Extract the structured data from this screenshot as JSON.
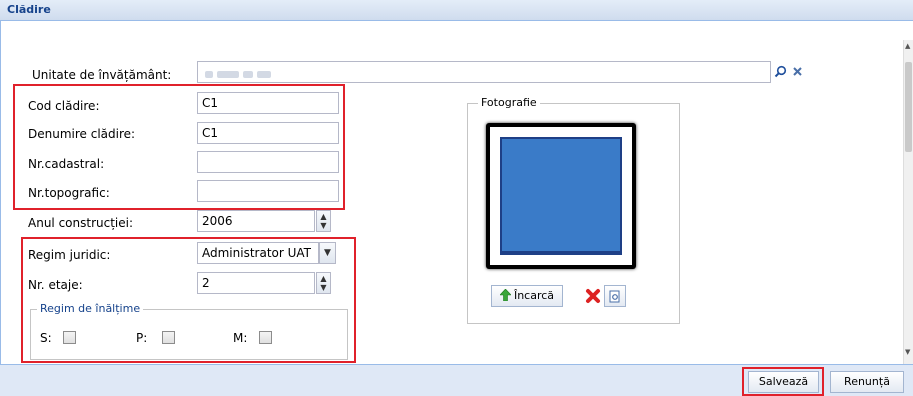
{
  "window": {
    "title": "Clădire"
  },
  "form": {
    "unitate_label": "Unitate de învățământ:",
    "cod_label": "Cod clădire:",
    "cod_value": "C1",
    "denumire_label": "Denumire clădire:",
    "denumire_value": "C1",
    "cadastral_label": "Nr.cadastral:",
    "cadastral_value": "",
    "topografic_label": "Nr.topografic:",
    "topografic_value": "",
    "anul_label": "Anul construcției:",
    "anul_value": "2006",
    "regim_label": "Regim juridic:",
    "regim_value": "Administrator UAT",
    "etaje_label": "Nr. etaje:",
    "etaje_value": "2",
    "inaltime_legend": "Regim de înălțime",
    "s_label": "S:",
    "p_label": "P:",
    "m_label": "M:"
  },
  "photo": {
    "legend": "Fotografie",
    "upload_label": "Încarcă"
  },
  "footer": {
    "save_label": "Salvează",
    "cancel_label": "Renunță"
  }
}
